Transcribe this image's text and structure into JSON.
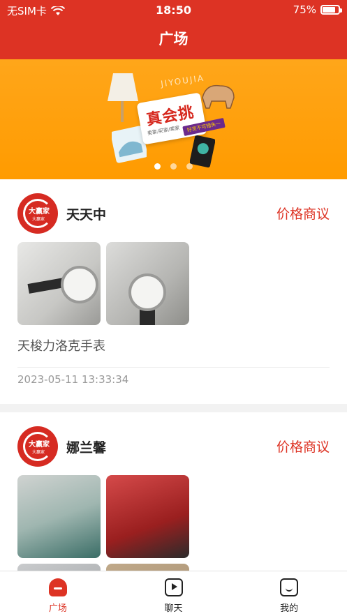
{
  "status_bar": {
    "carrier": "无SIM卡",
    "time": "18:50",
    "battery": "75%"
  },
  "header": {
    "title": "广场"
  },
  "banner": {
    "brand": "JIYOUJIA",
    "headline": "真会挑",
    "subline": "卖家/买家/卖家",
    "tag": "好货不可错失一",
    "slides": 3,
    "active_slide": 0
  },
  "posts": [
    {
      "username": "天天中",
      "action": "价格商议",
      "title": "天梭力洛克手表",
      "timestamp": "2023-05-11 13:33:34",
      "photos": [
        "watch-photo-1",
        "watch-photo-2"
      ]
    },
    {
      "username": "娜兰馨",
      "action": "价格商议",
      "photos": [
        "baby-walker-photo",
        "bag-photo",
        "photo-3",
        "photo-4"
      ]
    }
  ],
  "avatar_text": {
    "line1": "大赢家",
    "line2": "大赢家"
  },
  "tabs": [
    {
      "label": "广场",
      "icon": "square-icon",
      "active": true
    },
    {
      "label": "聊天",
      "icon": "chat-icon",
      "active": false
    },
    {
      "label": "我的",
      "icon": "profile-icon",
      "active": false
    }
  ],
  "colors": {
    "brand_red": "#dd3324",
    "banner_orange": "#ff9b00"
  }
}
